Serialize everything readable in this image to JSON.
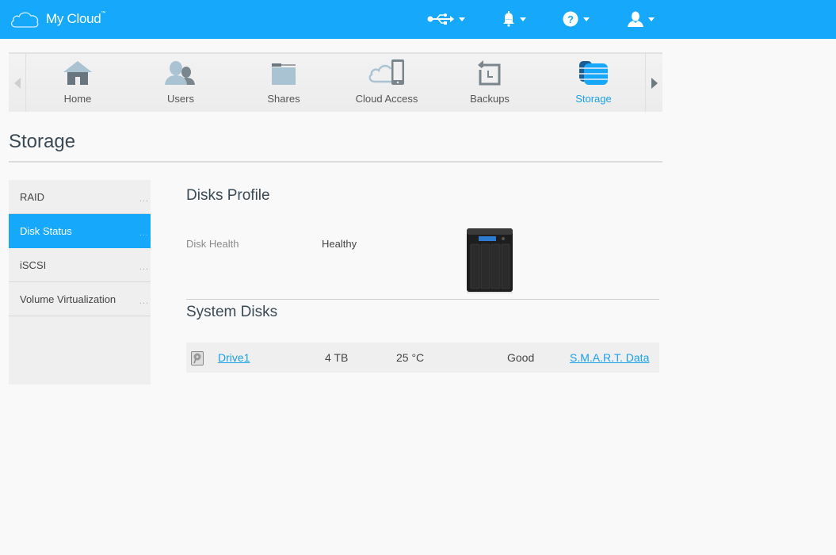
{
  "app": {
    "title": "My Cloud",
    "trademark": "™"
  },
  "topbar": {
    "icons": [
      {
        "name": "usb-icon"
      },
      {
        "name": "bell-icon"
      },
      {
        "name": "help-icon"
      },
      {
        "name": "user-icon"
      }
    ]
  },
  "nav": {
    "items": [
      {
        "label": "Home",
        "icon": "home-icon",
        "active": false
      },
      {
        "label": "Users",
        "icon": "users-icon",
        "active": false
      },
      {
        "label": "Shares",
        "icon": "folder-icon",
        "active": false
      },
      {
        "label": "Cloud Access",
        "icon": "cloud-device-icon",
        "active": false
      },
      {
        "label": "Backups",
        "icon": "backup-icon",
        "active": false
      },
      {
        "label": "Storage",
        "icon": "storage-icon",
        "active": true
      }
    ]
  },
  "page": {
    "title": "Storage"
  },
  "sidebar": {
    "items": [
      {
        "label": "RAID",
        "active": false
      },
      {
        "label": "Disk Status",
        "active": true
      },
      {
        "label": "iSCSI",
        "active": false
      },
      {
        "label": "Volume Virtualization",
        "active": false
      }
    ],
    "more": "..."
  },
  "disks_profile": {
    "title": "Disks Profile",
    "health_label": "Disk Health",
    "health_value": "Healthy"
  },
  "system_disks": {
    "title": "System Disks",
    "rows": [
      {
        "name": "Drive1",
        "size": "4 TB",
        "temp": "25 °C",
        "status": "Good",
        "smart_link": "S.M.A.R.T. Data"
      }
    ]
  },
  "colors": {
    "accent": "#15a8fb",
    "link": "#1aa0e8"
  }
}
